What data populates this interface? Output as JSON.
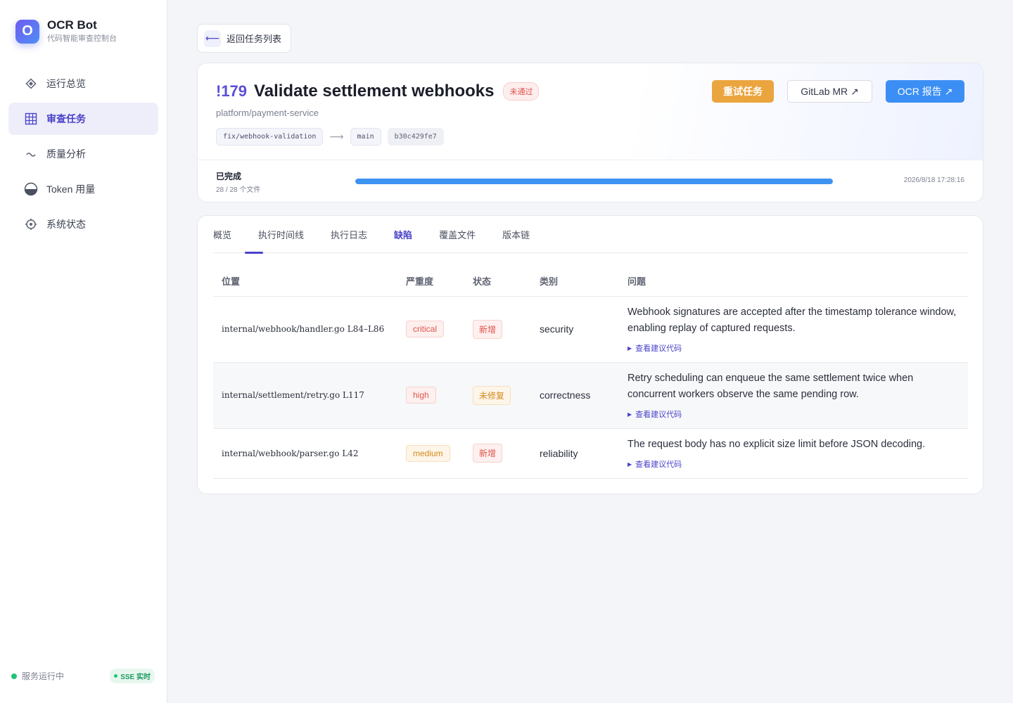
{
  "brand": {
    "logo_letter": "O",
    "title": "OCR Bot",
    "subtitle": "代码智能审查控制台"
  },
  "nav": [
    {
      "label": "运行总览",
      "icon": "diamond-icon",
      "active": false
    },
    {
      "label": "审查任务",
      "icon": "grid-icon",
      "active": true
    },
    {
      "label": "质量分析",
      "icon": "wave-icon",
      "active": false
    },
    {
      "label": "Token 用量",
      "icon": "half-circle-icon",
      "active": false
    },
    {
      "label": "系统状态",
      "icon": "gear-icon",
      "active": false
    }
  ],
  "footer": {
    "status": "服务运行中",
    "sse": "SSE 实时",
    "status_color": "#22c27a"
  },
  "back": {
    "arrow": "⟵",
    "label": "返回任务列表"
  },
  "mr": {
    "id": "!179",
    "title": "Validate settlement webhooks",
    "status": "未通过",
    "repo": "platform/payment-service",
    "source_branch": "fix/webhook-validation",
    "branch_arrow": "⟶",
    "target_branch": "main",
    "commit": "b30c429fe7"
  },
  "actions": {
    "retry": "重试任务",
    "gitlab": "GitLab MR ↗",
    "ocr": "OCR 报告 ↗"
  },
  "progress": {
    "label": "已完成",
    "count": "28 / 28 个文件",
    "fraction": 1.0,
    "timestamp": "2026/8/18 17:28:16"
  },
  "tabs": [
    {
      "label": "概览",
      "active": false
    },
    {
      "label": "执行时间线",
      "active": false
    },
    {
      "label": "执行日志",
      "active": false
    },
    {
      "label": "缺陷",
      "active": true
    },
    {
      "label": "覆盖文件",
      "active": false
    },
    {
      "label": "版本链",
      "active": false
    }
  ],
  "table": {
    "headers": {
      "location": "位置",
      "severity": "严重度",
      "status": "状态",
      "category": "类别",
      "issue": "问题"
    },
    "suggest_label": "查看建议代码",
    "rows": [
      {
        "location": "internal/webhook/handler.go L84–L86",
        "severity": "critical",
        "status": "新增",
        "category": "security",
        "issue": "Webhook signatures are accepted after the timestamp tolerance window, enabling replay of captured requests."
      },
      {
        "location": "internal/settlement/retry.go L117",
        "severity": "high",
        "status": "未修复",
        "category": "correctness",
        "issue": "Retry scheduling can enqueue the same settlement twice when concurrent workers observe the same pending row."
      },
      {
        "location": "internal/webhook/parser.go L42",
        "severity": "medium",
        "status": "新增",
        "category": "reliability",
        "issue": "The request body has no explicit size limit before JSON decoding."
      }
    ]
  }
}
